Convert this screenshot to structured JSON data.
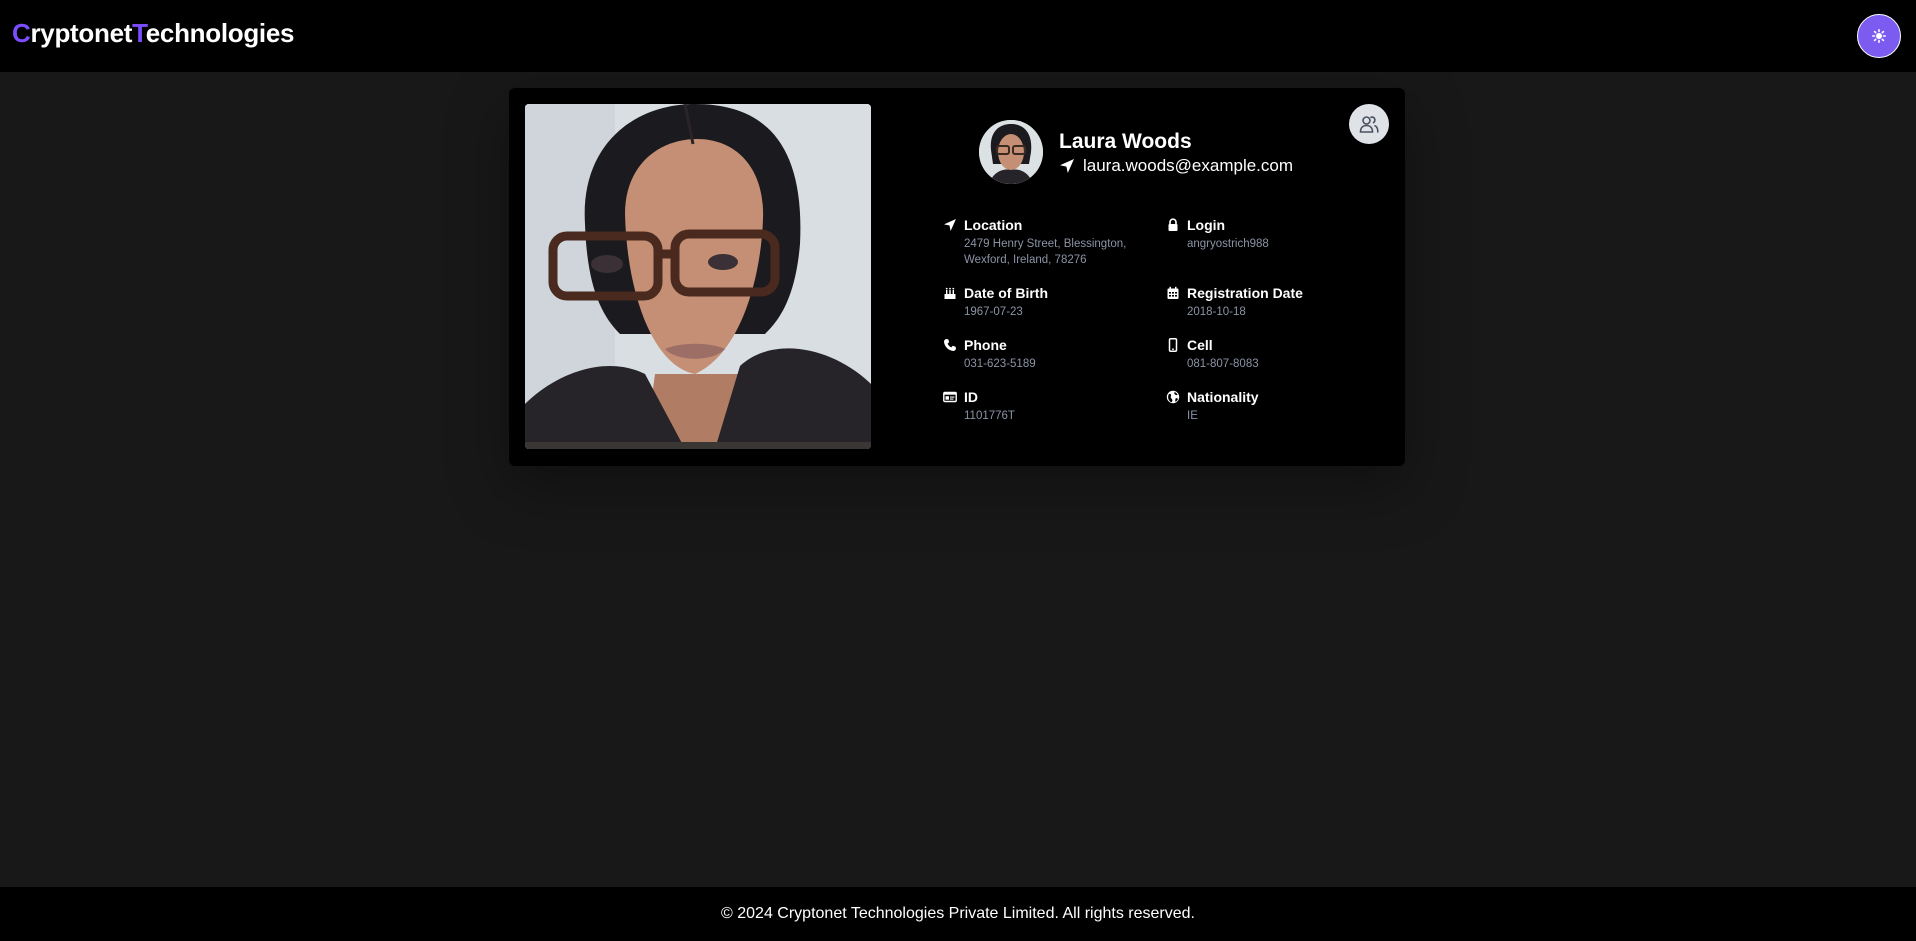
{
  "brand": {
    "first_initial": "C",
    "first_rest": "ryptonet",
    "second_initial": "T",
    "second_rest": "echnologies",
    "accent_color": "#7c4dff"
  },
  "header": {
    "theme_toggle_icon": "sun-icon"
  },
  "profile": {
    "name": "Laura Woods",
    "email": "laura.woods@example.com",
    "switch_icon": "users-icon",
    "details": [
      {
        "key": "location",
        "label": "Location",
        "value": "2479 Henry Street, Blessington, Wexford, Ireland, 78276",
        "icon": "location-arrow-icon"
      },
      {
        "key": "login",
        "label": "Login",
        "value": "angryostrich988",
        "icon": "lock-icon"
      },
      {
        "key": "dob",
        "label": "Date of Birth",
        "value": "1967-07-23",
        "icon": "cake-icon"
      },
      {
        "key": "registration",
        "label": "Registration Date",
        "value": "2018-10-18",
        "icon": "calendar-icon"
      },
      {
        "key": "phone",
        "label": "Phone",
        "value": "031-623-5189",
        "icon": "phone-icon"
      },
      {
        "key": "cell",
        "label": "Cell",
        "value": "081-807-8083",
        "icon": "mobile-icon"
      },
      {
        "key": "id",
        "label": "ID",
        "value": "1101776T",
        "icon": "id-card-icon"
      },
      {
        "key": "nationality",
        "label": "Nationality",
        "value": "IE",
        "icon": "globe-icon"
      }
    ]
  },
  "footer": {
    "text": "© 2024 Cryptonet Technologies Private Limited. All rights reserved."
  }
}
